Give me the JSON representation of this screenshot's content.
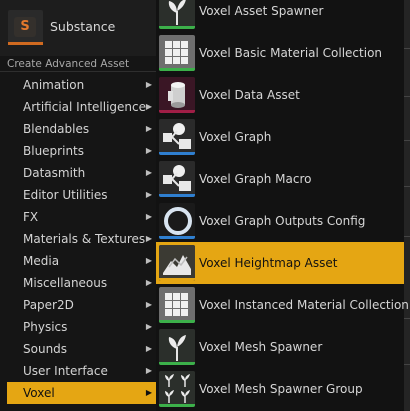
{
  "substance": {
    "label": "Substance",
    "icon": "substance-s-icon",
    "icon_glyph": "S",
    "accent": "#d06a20"
  },
  "advanced": {
    "header": "Create Advanced Asset",
    "categories": [
      {
        "label": "Animation",
        "arrow": "▶"
      },
      {
        "label": "Artificial Intelligence",
        "arrow": "▶"
      },
      {
        "label": "Blendables",
        "arrow": "▶"
      },
      {
        "label": "Blueprints",
        "arrow": "▶"
      },
      {
        "label": "Datasmith",
        "arrow": "▶"
      },
      {
        "label": "Editor Utilities",
        "arrow": "▶"
      },
      {
        "label": "FX",
        "arrow": "▶"
      },
      {
        "label": "Materials & Textures",
        "arrow": "▶"
      },
      {
        "label": "Media",
        "arrow": "▶"
      },
      {
        "label": "Miscellaneous",
        "arrow": "▶"
      },
      {
        "label": "Paper2D",
        "arrow": "▶"
      },
      {
        "label": "Physics",
        "arrow": "▶"
      },
      {
        "label": "Sounds",
        "arrow": "▶"
      },
      {
        "label": "User Interface",
        "arrow": "▶"
      },
      {
        "label": "Voxel",
        "arrow": "▶",
        "selected": true
      }
    ],
    "selected_color": "#e5a613"
  },
  "voxel_assets": [
    {
      "label": "Voxel Asset Spawner",
      "icon": "plant-sprout-icon",
      "stripe": "#3cb04a"
    },
    {
      "label": "Voxel Basic Material Collection",
      "icon": "material-grid-icon",
      "stripe": "#3cb04a"
    },
    {
      "label": "Voxel Data Asset",
      "icon": "data-cylinder-icon",
      "stripe": "#a01e46"
    },
    {
      "label": "Voxel Graph",
      "icon": "graph-nodes-icon",
      "stripe": "#2f7fd0"
    },
    {
      "label": "Voxel Graph Macro",
      "icon": "graph-nodes-icon",
      "stripe": "#2f7fd0"
    },
    {
      "label": "Voxel Graph Outputs Config",
      "icon": "ring-icon",
      "stripe": "#2f7fd0"
    },
    {
      "label": "Voxel Heightmap Asset",
      "icon": "heightmap-icon",
      "stripe": "#e5a613",
      "selected": true
    },
    {
      "label": "Voxel Instanced Material Collection",
      "icon": "material-grid-icon",
      "stripe": "#3cb04a"
    },
    {
      "label": "Voxel Mesh Spawner",
      "icon": "plant-sprout-icon",
      "stripe": "#3cb04a"
    },
    {
      "label": "Voxel Mesh Spawner Group",
      "icon": "plant-group-icon",
      "stripe": "#3cb04a"
    }
  ]
}
